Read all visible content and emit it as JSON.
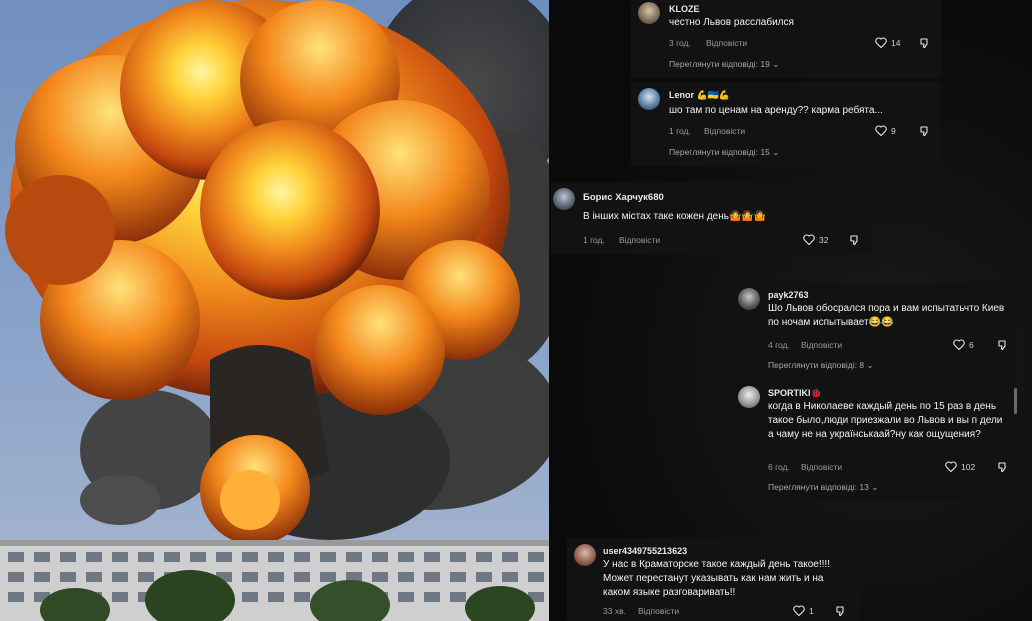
{
  "comments": [
    {
      "user": "KLOZE",
      "text": "честно Львов расслабился",
      "time": "3 год.",
      "reply": "Відповісти",
      "likes": "14",
      "more": "Переглянути відповіді: 19"
    },
    {
      "user": "Lenor 💪🇺🇦💪",
      "text": "шо там по ценам на аренду?? карма ребята...",
      "time": "1 год.",
      "reply": "Відповісти",
      "likes": "9",
      "more": "Переглянути відповіді: 15"
    },
    {
      "user": "Борис Харчук680",
      "text": "В інших містах таке кожен день🤷🤷🤷",
      "time": "1 год.",
      "reply": "Відповісти",
      "likes": "32"
    },
    {
      "user": "payk2763",
      "text": "Шо Львов обосрался пора и вам испытатьчто Киев по ночам испытывает😂😂",
      "time": "4 год.",
      "reply": "Відповісти",
      "likes": "6",
      "more": "Переглянути відповіді: 8"
    },
    {
      "user": "SPORTIKI🐞",
      "text": "когда в Николаеве каждый день по 15 раз в день такое было,люди приезжали во Львов и вы п  дели а чаму не на українськаай?ну как ощущения?",
      "time": "6 год.",
      "reply": "Відповісти",
      "likes": "102",
      "more": "Переглянути відповіді: 13"
    },
    {
      "user": "user4349755213623",
      "text": "У нас в Краматорске такое каждый день такое!!!! Может перестанут указывать как нам жить и на каком языке разговаривать!!",
      "time": "33 хв.",
      "reply": "Відповісти",
      "likes": "1"
    }
  ]
}
